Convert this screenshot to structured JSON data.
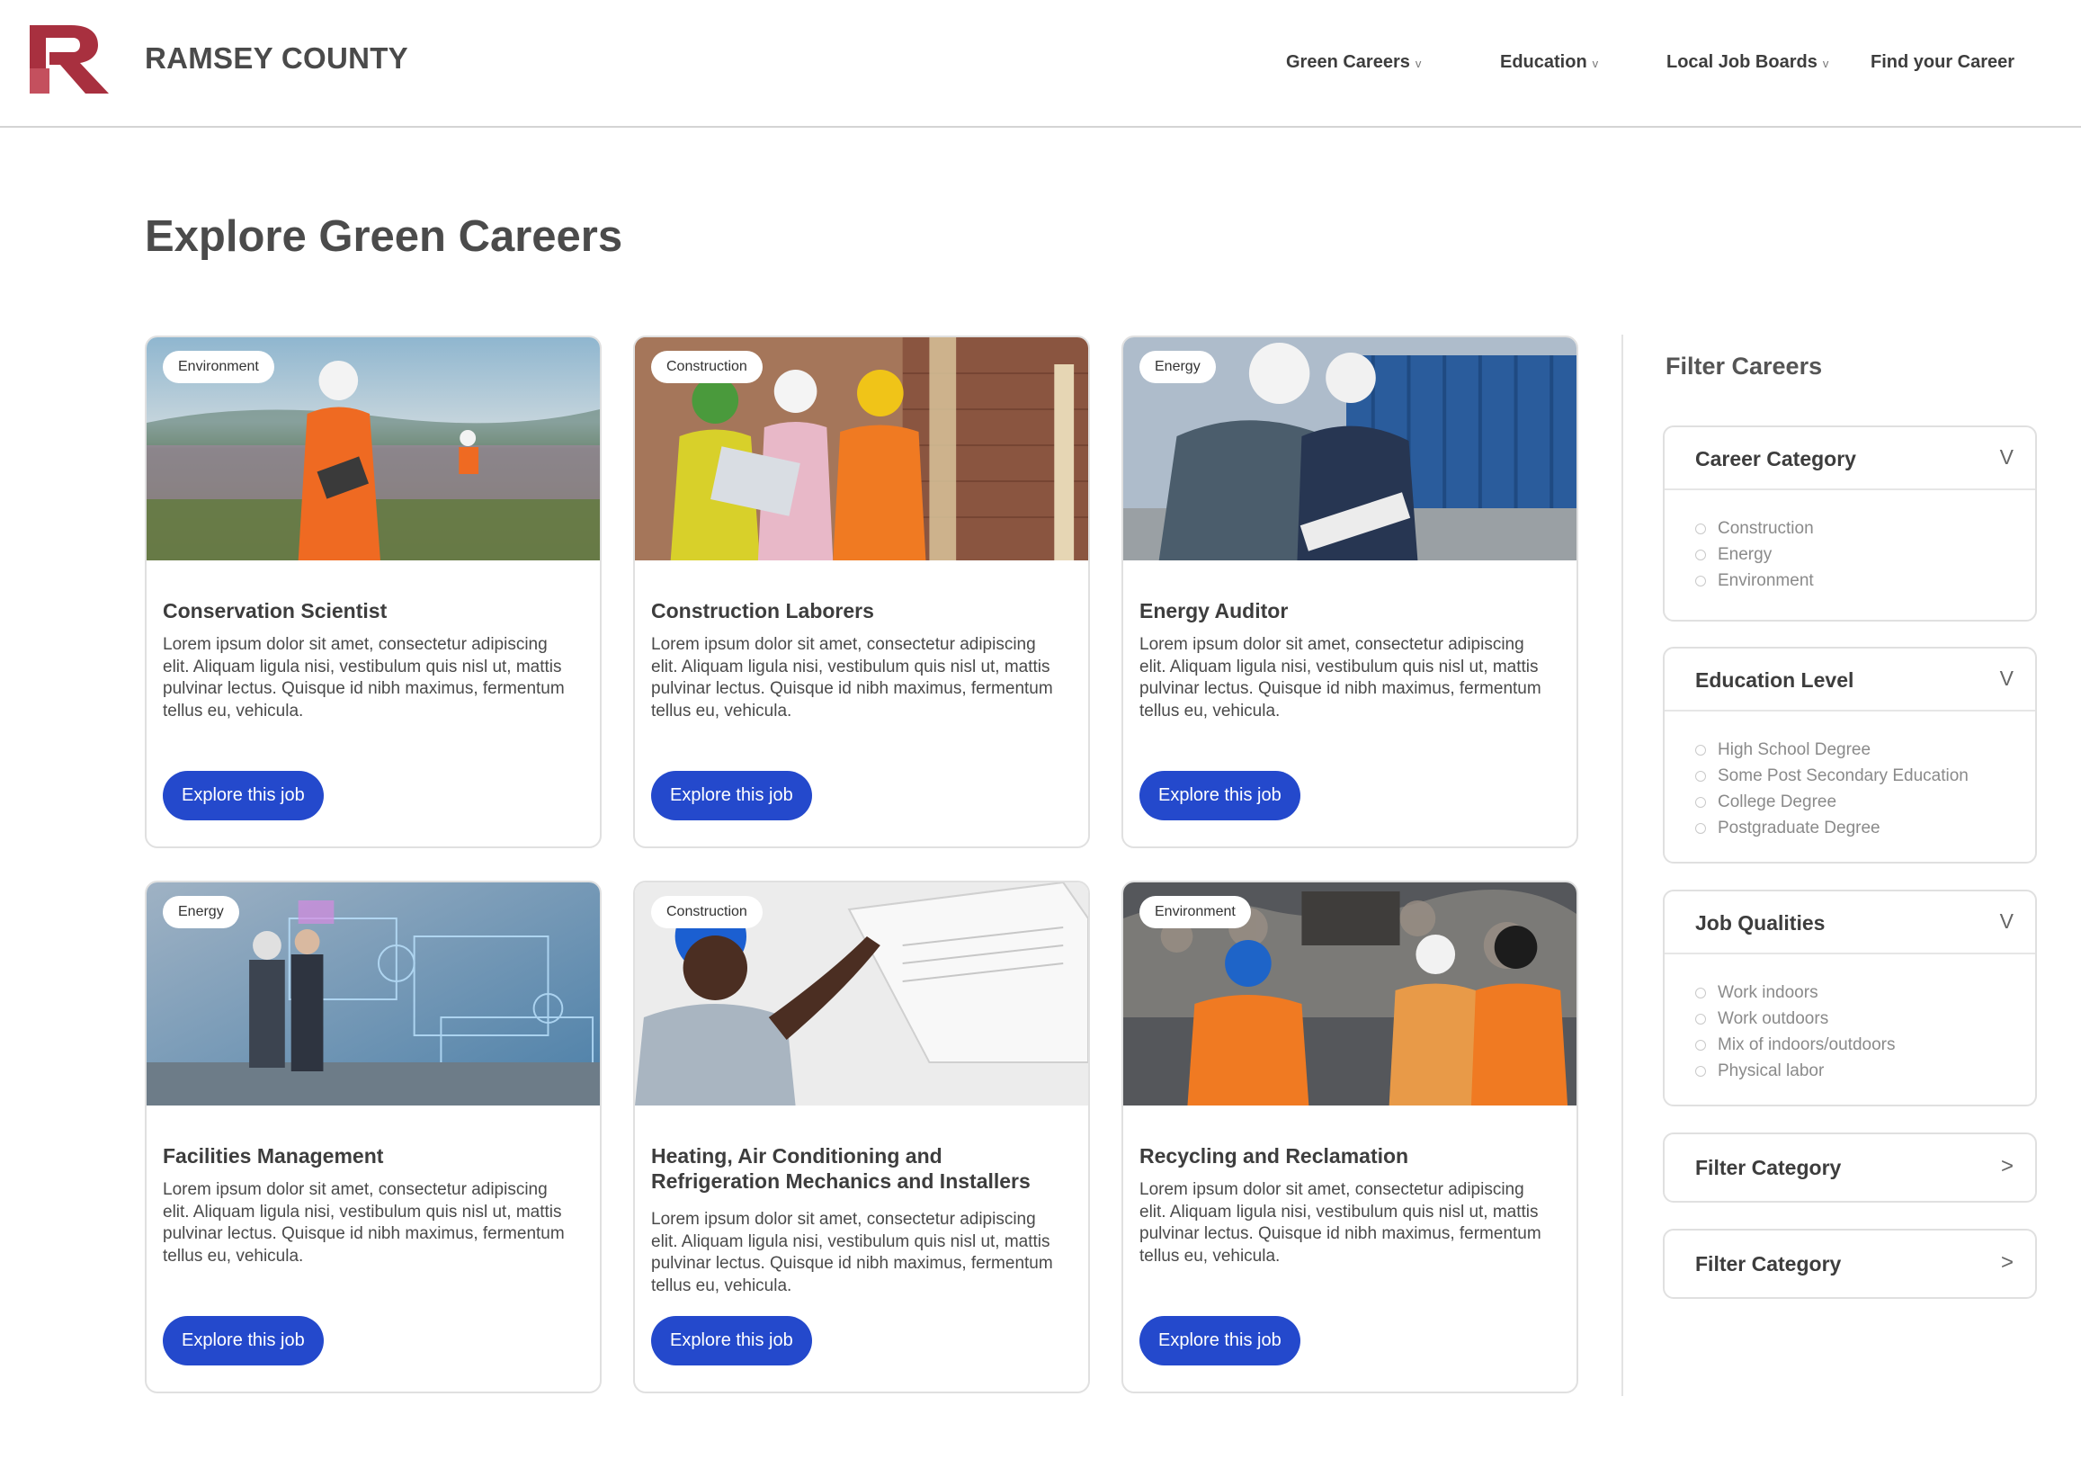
{
  "header": {
    "brand": "RAMSEY COUNTY",
    "nav": [
      {
        "label": "Green Careers",
        "chevron": "v"
      },
      {
        "label": "Education",
        "chevron": "v"
      },
      {
        "label": "Local Job Boards",
        "chevron": "v"
      },
      {
        "label": "Find your Career"
      }
    ]
  },
  "page_title": "Explore Green Careers",
  "cards": [
    {
      "tag": "Environment",
      "title": "Conservation Scientist",
      "desc": "Lorem ipsum dolor sit amet, consectetur adipiscing elit. Aliquam ligula nisi, vestibulum quis nisl ut, mattis pulvinar lectus. Quisque id nibh maximus, fermentum tellus eu, vehicula.",
      "button": "Explore this job",
      "image": "worker in wildflower field"
    },
    {
      "tag": "Construction",
      "title": "Construction Laborers",
      "desc": "Lorem ipsum dolor sit amet, consectetur adipiscing elit. Aliquam ligula nisi, vestibulum quis nisl ut, mattis pulvinar lectus. Quisque id nibh maximus, fermentum tellus eu, vehicula.",
      "button": "Explore this job",
      "image": "construction crew at brick site"
    },
    {
      "tag": "Energy",
      "title": "Energy Auditor",
      "desc": "Lorem ipsum dolor sit amet, consectetur adipiscing elit. Aliquam ligula nisi, vestibulum quis nisl ut, mattis pulvinar lectus. Quisque id nibh maximus, fermentum tellus eu, vehicula.",
      "button": "Explore this job",
      "image": "engineers reviewing plans at shipping yard"
    },
    {
      "tag": "Energy",
      "title": "Facilities Management",
      "desc": "Lorem ipsum dolor sit amet, consectetur adipiscing elit. Aliquam ligula nisi, vestibulum quis nisl ut, mattis pulvinar lectus. Quisque id nibh maximus, fermentum tellus eu, vehicula.",
      "button": "Explore this job",
      "image": "facility with holographic equipment"
    },
    {
      "tag": "Construction",
      "title": "Heating, Air Conditioning and Refrigeration Mechanics and Installers",
      "desc": "Lorem ipsum dolor sit amet, consectetur adipiscing elit. Aliquam ligula nisi, vestibulum quis nisl ut, mattis pulvinar lectus. Quisque id nibh maximus, fermentum tellus eu, vehicula.",
      "button": "Explore this job",
      "image": "technician servicing air conditioner"
    },
    {
      "tag": "Environment",
      "title": "Recycling and Reclamation",
      "desc": "Lorem ipsum dolor sit amet, consectetur adipiscing elit. Aliquam ligula nisi, vestibulum quis nisl ut, mattis pulvinar lectus. Quisque id nibh maximus, fermentum tellus eu, vehicula.",
      "button": "Explore this job",
      "image": "workers at scrap metal yard"
    }
  ],
  "filters": {
    "title": "Filter Careers",
    "groups": [
      {
        "label": "Career Category",
        "arrow": "V",
        "options": [
          "Construction",
          "Energy",
          "Environment"
        ]
      },
      {
        "label": "Education Level",
        "arrow": "V",
        "options": [
          "High School Degree",
          "Some Post Secondary Education",
          "College Degree",
          "Postgraduate Degree"
        ]
      },
      {
        "label": "Job Qualities",
        "arrow": "V",
        "options": [
          "Work indoors",
          "Work outdoors",
          "Mix of indoors/outdoors",
          "Physical labor"
        ]
      }
    ],
    "collapsed": [
      {
        "label": "Filter Category",
        "arrow": ">"
      },
      {
        "label": "Filter Category",
        "arrow": ">"
      }
    ]
  },
  "colors": {
    "brand": "#a8303f",
    "button": "#2449cc",
    "border": "#e0e0e0"
  }
}
